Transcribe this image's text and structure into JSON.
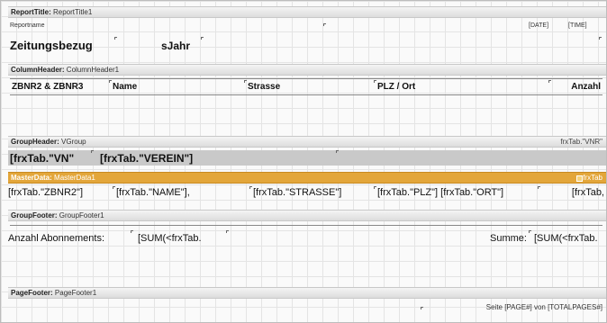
{
  "report_title_band": {
    "label": "ReportTitle:",
    "name": "ReportTitle1",
    "reportname": "Reportname",
    "date": "[DATE]",
    "time": "[TIME]",
    "heading": "Zeitungsbezug",
    "year_field": "sJahr"
  },
  "column_header_band": {
    "label": "ColumnHeader:",
    "name": "ColumnHeader1",
    "columns": [
      "ZBNR2 & ZBNR3",
      "Name",
      "Strasse",
      "PLZ / Ort",
      "Anzahl"
    ]
  },
  "group_header_band": {
    "label": "GroupHeader:",
    "name": "VGroup",
    "condition": "frxTab.\"VNR\"",
    "field_vn": "[frxTab.\"VN\"",
    "field_verein": "[frxTab.\"VEREIN\"]"
  },
  "master_data_band": {
    "label": "MasterData:",
    "name": "MasterData1",
    "dataset": "frxTab",
    "fields": [
      "[frxTab.\"ZBNR2\"]",
      "[frxTab.\"NAME\"],",
      "[frxTab.\"STRASSE\"]",
      "[frxTab.\"PLZ\"] [frxTab.\"ORT\"]",
      "[frxTab,"
    ]
  },
  "group_footer_band": {
    "label": "GroupFooter:",
    "name": "GroupFooter1",
    "count_label": "Anzahl Abonnements:",
    "count_expr": "[SUM(<frxTab.",
    "sum_label": "Summe:",
    "sum_expr": "[SUM(<frxTab."
  },
  "page_footer_band": {
    "label": "PageFooter:",
    "name": "PageFooter1",
    "page_text": "Seite [PAGE#] von [TOTALPAGES#]"
  },
  "colors": {
    "master_band": "#e3a63a",
    "band_header": "#dcdcdc",
    "grid": "#e4e4e4"
  }
}
